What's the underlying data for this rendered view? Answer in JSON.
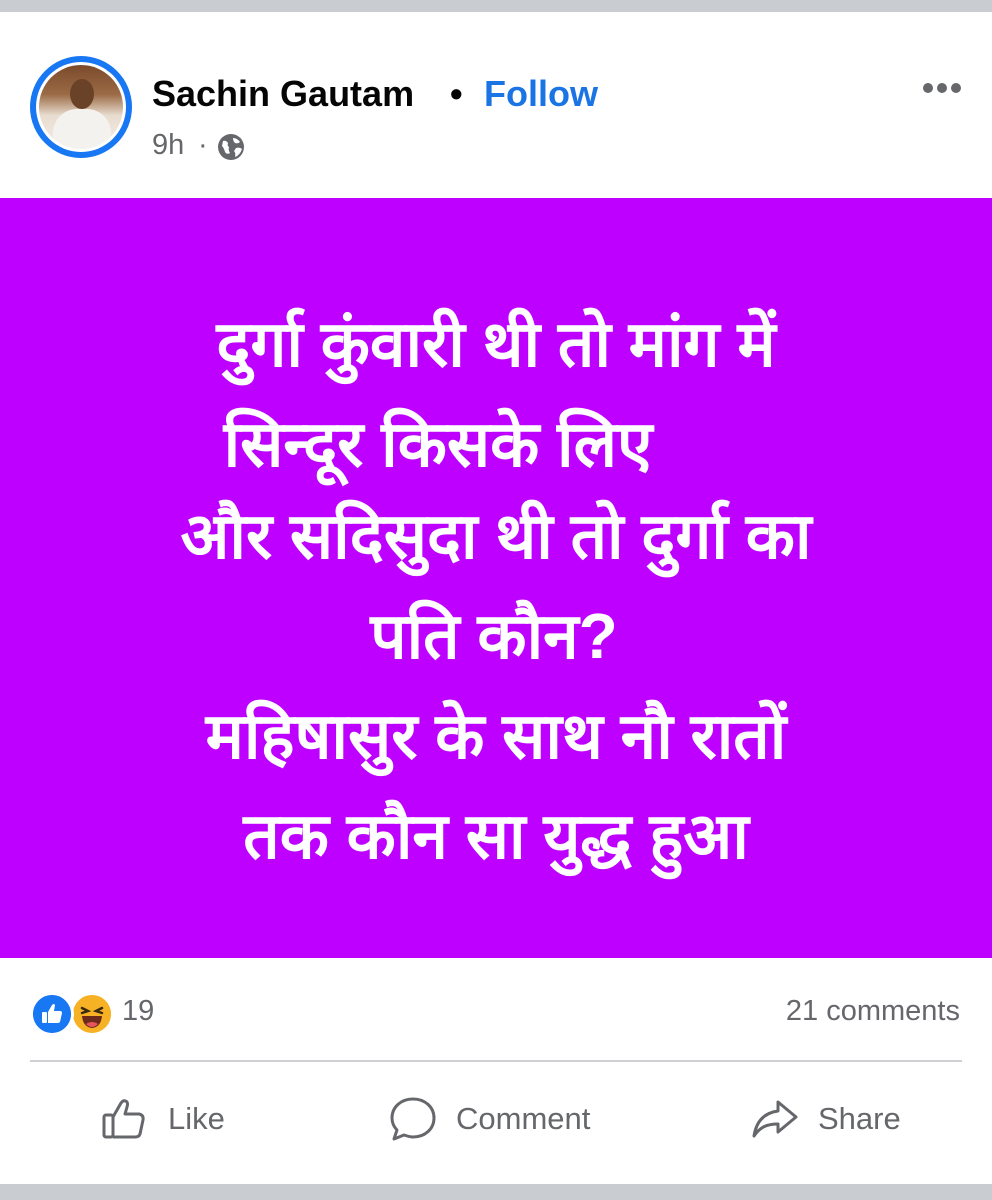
{
  "post": {
    "author_name": "Sachin Gautam",
    "separator": "•",
    "follow_label": "Follow",
    "time": "9h",
    "time_separator": "·",
    "audience_icon": "globe-icon",
    "more_icon": "more-options-icon"
  },
  "image": {
    "background_color": "#bd00ff",
    "text_color": "#ffffff",
    "lines": [
      "दुर्गा कुंवारी थी तो मांग में",
      "सिन्दूर किसके लिए",
      "और सदिसुदा थी तो दुर्गा का",
      "पति कौन?",
      "महिषासुर के साथ नौ रातों",
      "तक कौन सा युद्ध हुआ"
    ]
  },
  "reactions": {
    "icons": [
      "like-reaction-icon",
      "haha-reaction-icon"
    ],
    "count": "19",
    "comments": "21 comments"
  },
  "actions": {
    "like": "Like",
    "comment": "Comment",
    "share": "Share"
  },
  "colors": {
    "accent": "#1b74e4",
    "secondary_text": "#65676b",
    "divider": "#ced0d4"
  }
}
